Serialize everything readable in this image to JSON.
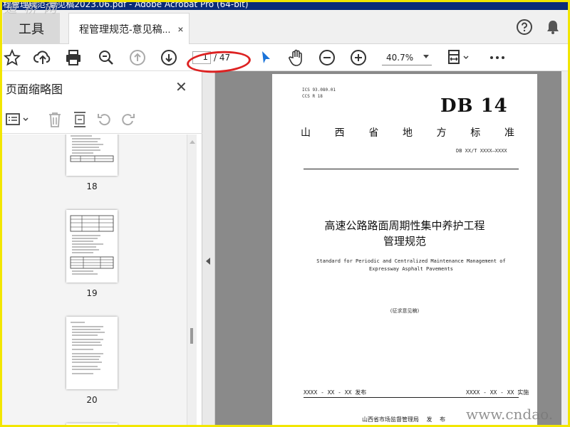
{
  "window": {
    "title": "程管理规范-意见稿2023.06.pdf - Adobe Acrobat Pro (64-bit)",
    "watermark_top": "道 桥 网",
    "watermark_bottom": "www.cndao."
  },
  "tabs": {
    "tools_label": "工具",
    "doc_label": "程管理规范-意见稿...",
    "close_glyph": "×"
  },
  "header_icons": [
    "help-icon",
    "bell-icon"
  ],
  "toolbar": {
    "icons": [
      "star-icon",
      "upload-icon",
      "print-icon",
      "zoom-search-icon",
      "prev-page-icon",
      "next-page-icon",
      "select-cursor-icon",
      "hand-icon",
      "zoom-out-icon",
      "zoom-in-icon",
      "fit-page-icon",
      "more-icon"
    ],
    "page_current": "1",
    "page_total": "/ 47",
    "zoom_value": "40.7%"
  },
  "sidebar": {
    "title": "页面缩略图",
    "close_glyph": "✕",
    "tools": [
      "thumbnail-options-icon",
      "delete-icon",
      "insert-page-icon",
      "rotate-left-icon",
      "rotate-right-icon"
    ],
    "thumbnails": [
      {
        "page": "18"
      },
      {
        "page": "19"
      },
      {
        "page": "20"
      }
    ]
  },
  "document": {
    "ics": "ICS  93.080.01",
    "ccs": "CCS  R 18",
    "db": "DB 14",
    "std_chars": [
      "山",
      "西",
      "省",
      "地",
      "方",
      "标",
      "准"
    ],
    "code": "DB XX/T XXXX—XXXX",
    "title_line1": "高速公路路面周期性集中养护工程",
    "title_line2": "管理规范",
    "en_line1": "Standard for Periodic and Centralized Maintenance Management of",
    "en_line2": "Expressway Asphalt Pavements",
    "draft": "(征求意见稿)",
    "issue": "XXXX - XX - XX 发布",
    "implement": "XXXX - XX - XX 实施",
    "publisher": "山西省市场监督管理局  发 布"
  }
}
